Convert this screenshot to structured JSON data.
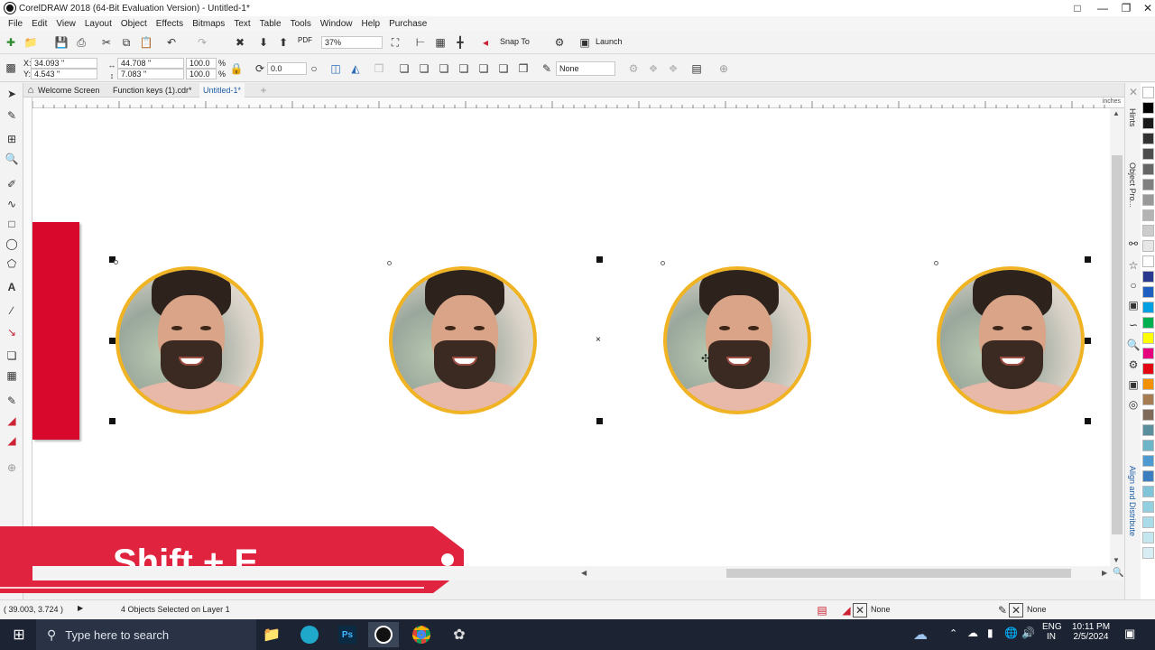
{
  "app": {
    "title": "CorelDRAW 2018 (64-Bit Evaluation Version) - Untitled-1*"
  },
  "menu": [
    "File",
    "Edit",
    "View",
    "Layout",
    "Object",
    "Effects",
    "Bitmaps",
    "Text",
    "Table",
    "Tools",
    "Window",
    "Help",
    "Purchase"
  ],
  "toolbar": {
    "zoom": "37%",
    "snap_to": "Snap To",
    "launch": "Launch",
    "pdf_label": "PDF"
  },
  "propbar": {
    "x_label": "X:",
    "x_value": "34.093 \"",
    "y_label": "Y:",
    "y_value": "4.543 \"",
    "width_value": "44.708 \"",
    "height_value": "7.083 \"",
    "scale_w": "100.0",
    "scale_h": "100.0",
    "percent": "%",
    "rotation": "0.0",
    "outline": "None"
  },
  "tabs": [
    {
      "label": "Welcome Screen"
    },
    {
      "label": "Function keys (1).cdr*"
    },
    {
      "label": "Untitled-1*"
    }
  ],
  "ruler": {
    "unit": "inches"
  },
  "dockers": {
    "hints": "Hints",
    "object_props": "Object Pro...",
    "align": "Align and Distribute"
  },
  "palette_colors": [
    "#ffffff",
    "#000000",
    "#1a1a1a",
    "#333333",
    "#4d4d4d",
    "#666666",
    "#808080",
    "#999999",
    "#b3b3b3",
    "#cccccc",
    "#e6e6e6",
    "#ffffff",
    "#2b3a8f",
    "#1f5fbf",
    "#00a0e3",
    "#00b050",
    "#ffff00",
    "#e6007e",
    "#e30613",
    "#f39200",
    "#a67c52",
    "#7f6a5a",
    "#5b8f9e",
    "#6fb5c8",
    "#4f9bd1",
    "#3b7dbf",
    "#7fc4d9",
    "#92d0e0",
    "#a9dbe8",
    "#c3e6ef",
    "#d7eef5"
  ],
  "canvas": {
    "object_count": 4,
    "shortcut_text": "Shift + E",
    "shortcut_color": "#e0233f"
  },
  "status": {
    "coords": "( 39.003, 3.724 )",
    "selection": "4 Objects Selected on Layer 1",
    "fill": "None",
    "outline": "None"
  },
  "taskbar": {
    "search_placeholder": "Type here to search",
    "lang_1": "ENG",
    "lang_2": "IN",
    "time": "10:11 PM",
    "date": "2/5/2024"
  }
}
